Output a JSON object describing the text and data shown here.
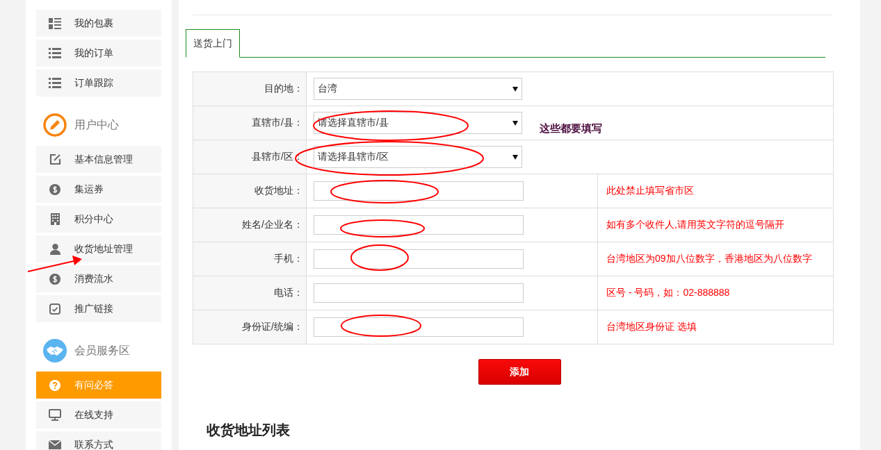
{
  "sidebar": {
    "groups": [
      {
        "items": [
          {
            "label": "我的包裹",
            "selected": false
          },
          {
            "label": "我的订单",
            "selected": false
          },
          {
            "label": "订单跟踪",
            "selected": false
          }
        ]
      },
      {
        "heading": "用户中心",
        "items": [
          {
            "label": "基本信息管理",
            "selected": false
          },
          {
            "label": "集运券",
            "selected": false
          },
          {
            "label": "积分中心",
            "selected": false
          },
          {
            "label": "收货地址管理",
            "selected": false
          },
          {
            "label": "消费流水",
            "selected": false
          },
          {
            "label": "推广链接",
            "selected": false
          }
        ]
      },
      {
        "heading": "会员服务区",
        "items": [
          {
            "label": "有问必答",
            "selected": true
          },
          {
            "label": "在线支持",
            "selected": false
          },
          {
            "label": "联系方式",
            "selected": false
          }
        ]
      }
    ]
  },
  "tabs": [
    {
      "label": "送货上门",
      "selected": true
    }
  ],
  "form": {
    "rows": [
      {
        "label": "目的地：",
        "kind": "select",
        "value": "台湾"
      },
      {
        "label": "直辖市/县：",
        "kind": "select",
        "value": "请选择直辖市/县"
      },
      {
        "label": "县辖市/区：",
        "kind": "select",
        "value": "请选择县辖市/区"
      },
      {
        "label": "收货地址：",
        "kind": "input",
        "hint": "此处禁止填写省市区"
      },
      {
        "label": "姓名/企业名：",
        "kind": "input",
        "hint": "如有多个收件人,请用英文字符的逗号隔开"
      },
      {
        "label": "手机：",
        "kind": "input",
        "hint": "台湾地区为09加八位数字，香港地区为八位数字"
      },
      {
        "label": "电话：",
        "kind": "input",
        "hint": "区号 - 号码，如：02-888888"
      },
      {
        "label": "身份证/统编：",
        "kind": "input",
        "hint": "台湾地区身份证 选填"
      }
    ],
    "submit": "添加"
  },
  "list_heading": "收货地址列表",
  "annotation": {
    "note": "这些都要填写"
  }
}
